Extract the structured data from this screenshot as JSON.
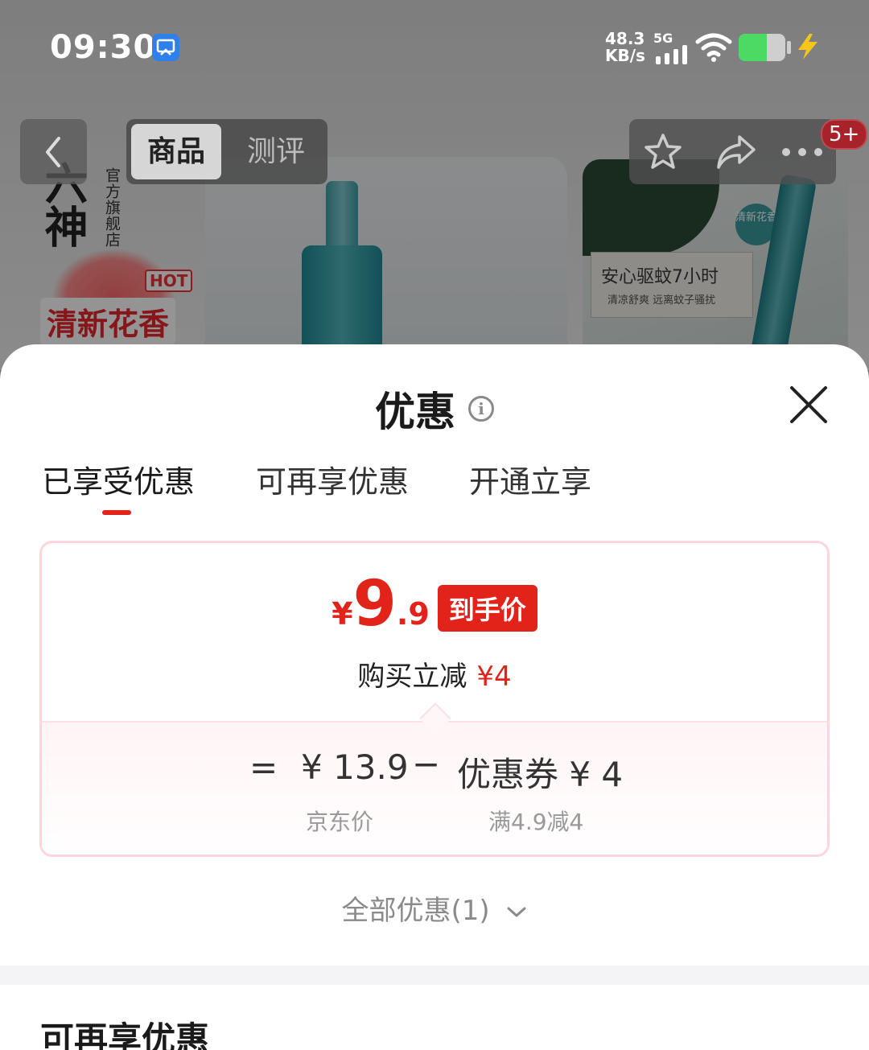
{
  "status_bar": {
    "time": "09:30",
    "net_speed_value": "48.3",
    "net_speed_unit": "KB/s",
    "network": "5G",
    "battery_level": 0.6
  },
  "product_page": {
    "brand_name": "六神",
    "store_label": "官方旗舰店",
    "hot_tag": "HOT",
    "scent_label": "清新花香",
    "right_label_main": "安心驱蚊7小时",
    "right_label_sub": "清凉舒爽  远离蚊子骚扰",
    "right_badge": "清新花香",
    "nav": {
      "tabs": [
        "商品",
        "测评"
      ],
      "badge": "5+"
    }
  },
  "sheet": {
    "title": "优惠",
    "tabs": [
      "已享受优惠",
      "可再享优惠",
      "开通立享"
    ],
    "price": {
      "currency": "¥",
      "integer": "9",
      "decimal": ".9",
      "tag": "到手价"
    },
    "reduce_text": "购买立减",
    "reduce_amount": "¥4",
    "calc": {
      "equals": "=",
      "jd_price": "¥ 13.9",
      "minus": "−",
      "coupon": "优惠券 ¥ 4",
      "jd_label": "京东价",
      "coupon_label": "满4.9减4"
    },
    "all_offers": "全部优惠(1)",
    "section_heading": "可再享优惠"
  },
  "colors": {
    "accent_red": "#e2231a",
    "card_border": "#fbd6dc"
  }
}
